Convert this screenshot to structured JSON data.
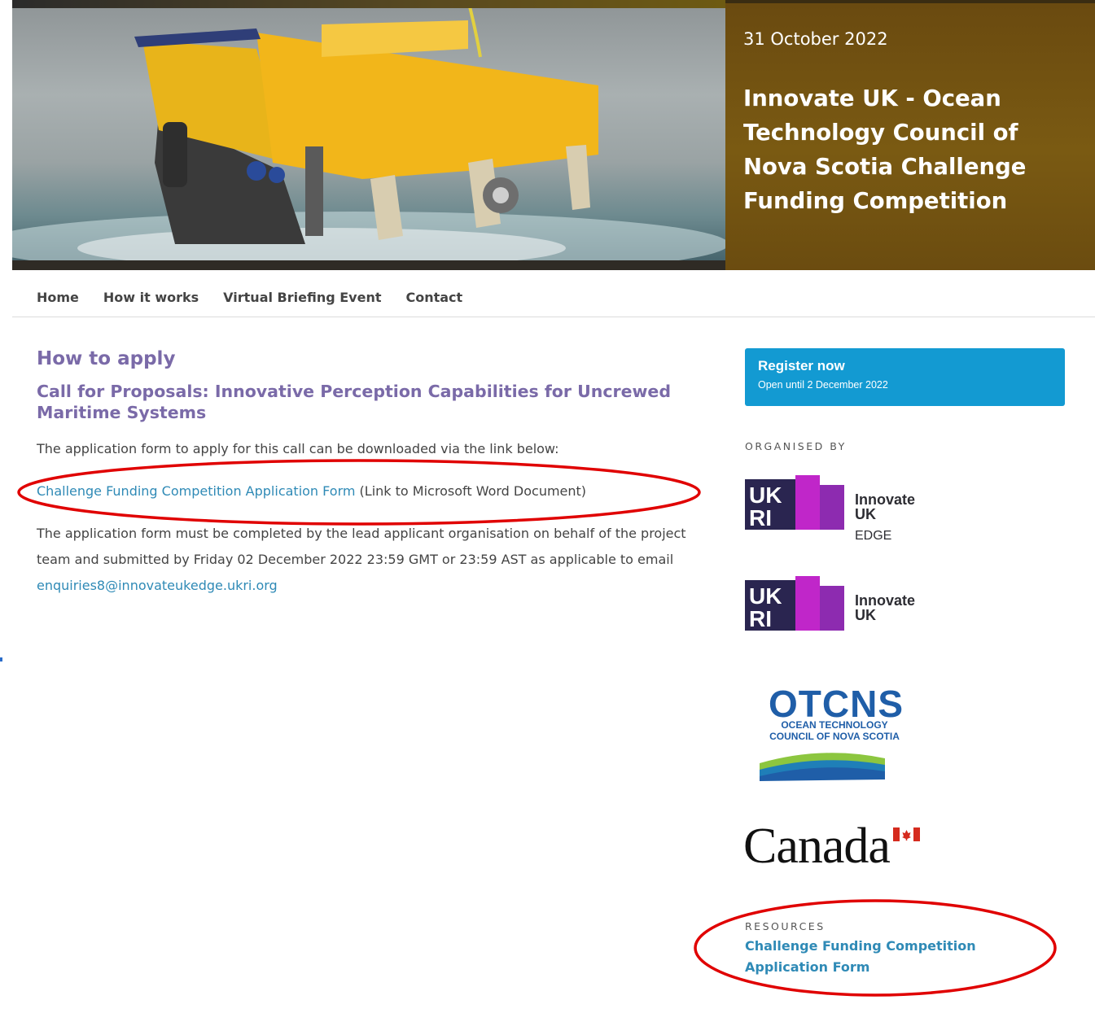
{
  "banner": {
    "date": "31 October 2022",
    "headline": "Innovate UK - Ocean Technology Council of Nova Scotia Challenge Funding Competition"
  },
  "nav": {
    "items": [
      {
        "label": "Home"
      },
      {
        "label": "How it works"
      },
      {
        "label": "Virtual Briefing Event"
      },
      {
        "label": "Contact"
      }
    ]
  },
  "main": {
    "title": "How to apply",
    "subtitle": "Call for Proposals: Innovative Perception Capabilities for Uncrewed Maritime Systems",
    "intro": "The application form to apply for this call can be downloaded via the link below:",
    "form_link": "Challenge Funding Competition Application Form",
    "form_link_note": " (Link to Microsoft Word Document)",
    "body_text": "The application form must be completed by the lead applicant organisation on behalf of the project team and submitted by Friday 02 December 2022 23:59 GMT or 23:59 AST as applicable to email ",
    "email": "enquiries8@innovateukedge.ukri.org"
  },
  "sidebar": {
    "register_title": "Register now",
    "register_sub": "Open until 2 December 2022",
    "organised_by": "ORGANISED BY",
    "logos": {
      "ukri_edge": {
        "line1": "Innovate",
        "line2": "UK",
        "line3": "EDGE"
      },
      "ukri": {
        "line1": "Innovate",
        "line2": "UK"
      },
      "otcns": {
        "big": "OTCNS",
        "small": "OCEAN TECHNOLOGY COUNCIL OF NOVA SCOTIA"
      },
      "canada": "Canada"
    },
    "resources_label": "RESOURCES",
    "resources_link": "Challenge Funding Competition Application Form"
  },
  "colors": {
    "heading_purple": "#7a6aa8",
    "link_blue": "#2f8ab6",
    "register_blue": "#139ad2",
    "banner_brown": "#7a5a12",
    "ukri_purple": "#c026c9",
    "annotation_red": "#e00000"
  }
}
